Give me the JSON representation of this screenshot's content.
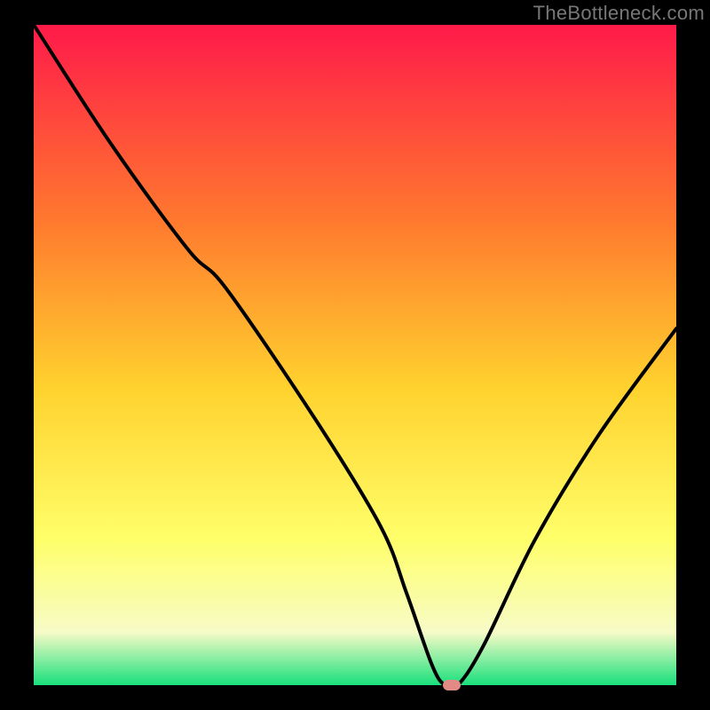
{
  "watermark": "TheBottleneck.com",
  "colors": {
    "frame": "#000000",
    "grad_top": "#ff1a4a",
    "grad_mid_upper": "#ff7a2e",
    "grad_mid": "#ffd22e",
    "grad_mid_lower": "#ffff6a",
    "grad_pale": "#f7fbc7",
    "grad_bottom": "#19e07c",
    "curve": "#000000",
    "marker": "#e48a86"
  },
  "chart_data": {
    "type": "line",
    "title": "",
    "xlabel": "",
    "ylabel": "",
    "xlim": [
      0,
      100
    ],
    "ylim": [
      0,
      100
    ],
    "series": [
      {
        "name": "bottleneck-curve",
        "x": [
          0,
          12,
          24,
          30,
          44,
          54,
          58,
          62,
          64,
          66,
          70,
          78,
          88,
          100
        ],
        "y": [
          100,
          82,
          66,
          60,
          40,
          24,
          14,
          3,
          0,
          0,
          6,
          22,
          38,
          54
        ]
      }
    ],
    "annotations": [
      {
        "name": "optimal-marker",
        "x": 65,
        "y": 0
      }
    ],
    "notes": "Y is bottleneck percentage; background vertical gradient maps high values (top) to red, low (bottom) to green."
  }
}
